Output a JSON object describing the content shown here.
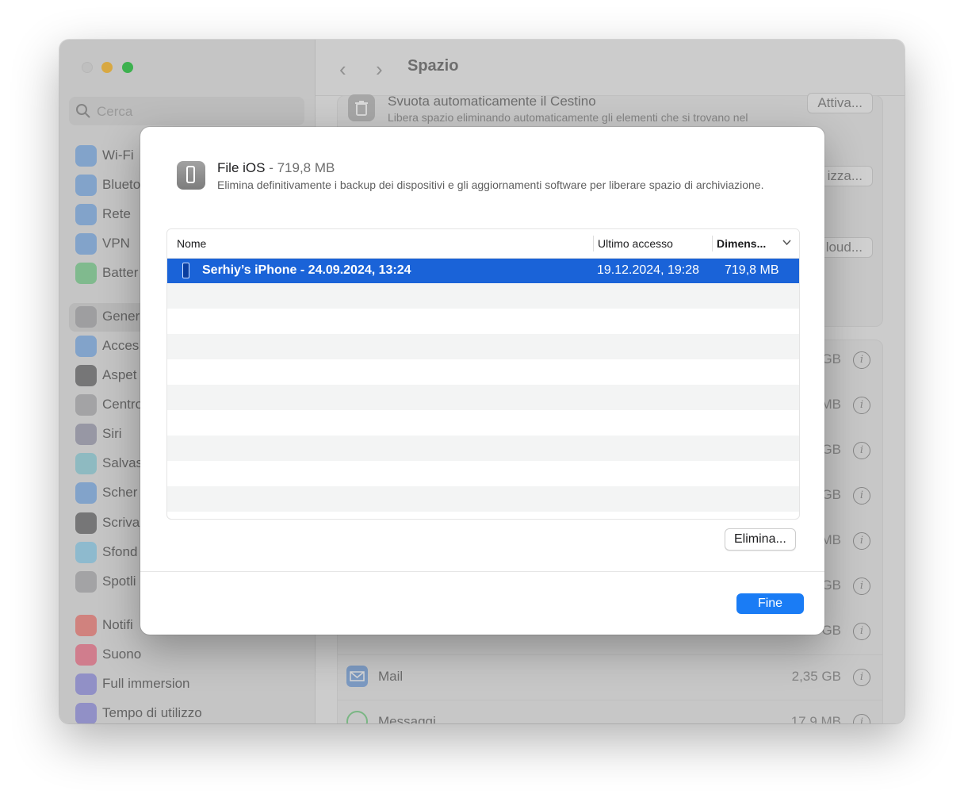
{
  "window": {
    "title": "Spazio"
  },
  "sidebar": {
    "search_placeholder": "Cerca",
    "items": [
      {
        "label": "Wi-Fi",
        "icon": "wifi-icon",
        "color": "#3b8cf0"
      },
      {
        "label": "Blueto",
        "icon": "bluetooth-icon",
        "color": "#3b8cf0"
      },
      {
        "label": "Rete",
        "icon": "network-globe-icon",
        "color": "#3b8cf0"
      },
      {
        "label": "VPN",
        "icon": "vpn-globe-icon",
        "color": "#3b8cf0"
      },
      {
        "label": "Batter",
        "icon": "battery-icon",
        "color": "#34c759"
      },
      {
        "label": "Gener",
        "icon": "gear-icon",
        "color": "#8e8e93"
      },
      {
        "label": "Acces",
        "icon": "accessibility-icon",
        "color": "#3b8cf0"
      },
      {
        "label": "Aspet",
        "icon": "appearance-icon",
        "color": "#1d1d1f"
      },
      {
        "label": "Centro",
        "icon": "control-center-icon",
        "color": "#8e8e93"
      },
      {
        "label": "Siri",
        "icon": "siri-icon",
        "color": "#6f6f8f"
      },
      {
        "label": "Salvas",
        "icon": "screensaver-icon",
        "color": "#5ac8d8"
      },
      {
        "label": "Scher",
        "icon": "display-icon",
        "color": "#3b8cf0"
      },
      {
        "label": "Scriva",
        "icon": "desktop-dock-icon",
        "color": "#1d1d1f"
      },
      {
        "label": "Sfond",
        "icon": "wallpaper-icon",
        "color": "#5ac8fa"
      },
      {
        "label": "Spotli",
        "icon": "spotlight-icon",
        "color": "#8e8e93"
      },
      {
        "label": "Notifi",
        "icon": "notifications-icon",
        "color": "#ff3b30"
      },
      {
        "label": "Suono",
        "icon": "sound-icon",
        "color": "#ff2d55"
      },
      {
        "label": "Full immersion",
        "icon": "focus-moon-icon",
        "color": "#5e5ce6"
      },
      {
        "label": "Tempo di utilizzo",
        "icon": "screen-time-icon",
        "color": "#5e5ce6"
      }
    ]
  },
  "main": {
    "trash_title": "Svuota automaticamente il Cestino",
    "trash_desc": "Libera spazio eliminando automaticamente gli elementi che si trovano nel",
    "activate_label": "Attiva...",
    "optimize_label": "izza...",
    "icloud_label": "loud...",
    "sizes": [
      "GB",
      "MB",
      "GB",
      "GB",
      "MB",
      "GB",
      "GB"
    ],
    "rows": [
      {
        "name": "Mail",
        "size": "2,35 GB"
      },
      {
        "name": "Messaggi",
        "size": "17,9 MB"
      }
    ]
  },
  "dialog": {
    "title": "File iOS",
    "size": " - 719,8 MB",
    "description": "Elimina definitivamente i backup dei dispositivi e gli aggiornamenti software per liberare spazio di archiviazione.",
    "columns": {
      "name": "Nome",
      "last_access": "Ultimo accesso",
      "size": "Dimens..."
    },
    "rows": [
      {
        "name": "Serhiy’s iPhone - 24.09.2024, 13:24",
        "last_access": "19.12.2024, 19:28",
        "size": "719,8 MB"
      }
    ],
    "delete_label": "Elimina...",
    "done_label": "Fine"
  }
}
